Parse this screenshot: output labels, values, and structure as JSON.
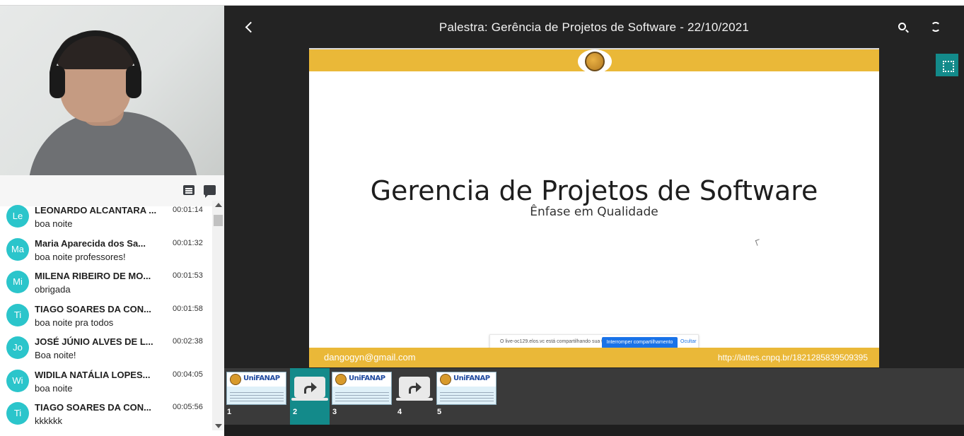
{
  "header": {
    "title": "Palestra: Gerência de Projetos de Software - 22/10/2021",
    "back_icon": "chevron-left-icon",
    "search_icon": "search-icon",
    "refresh_icon": "refresh-icon",
    "fullscreen_icon": "fullscreen-icon"
  },
  "chat": {
    "toolbar_icons": [
      "notes-icon",
      "chat-icon"
    ],
    "messages": [
      {
        "initials": "Le",
        "name": "LEONARDO ALCANTARA ...",
        "time": "00:01:14",
        "text": "boa noite"
      },
      {
        "initials": "Ma",
        "name": "Maria Aparecida dos Sa...",
        "time": "00:01:32",
        "text": "boa noite professores!"
      },
      {
        "initials": "Mi",
        "name": "MILENA RIBEIRO DE MO...",
        "time": "00:01:53",
        "text": "obrigada"
      },
      {
        "initials": "Ti",
        "name": "TIAGO SOARES DA CON...",
        "time": "00:01:58",
        "text": "boa noite pra todos"
      },
      {
        "initials": "Jo",
        "name": "JOSÉ JÚNIO ALVES DE L...",
        "time": "00:02:38",
        "text": "Boa noite!"
      },
      {
        "initials": "Wi",
        "name": "WIDILA NATÁLIA LOPES...",
        "time": "00:04:05",
        "text": "boa noite"
      },
      {
        "initials": "Ti",
        "name": "TIAGO SOARES DA CON...",
        "time": "00:05:56",
        "text": "kkkkkk"
      }
    ]
  },
  "slide": {
    "title": "Gerencia de Projetos de Software",
    "subtitle": "Ênfase em Qualidade",
    "email": "dangogyn@gmail.com",
    "url": "http://lattes.cnpq.br/1821285839509395",
    "share_notice": {
      "text": "O live-oc129.elos.vc está compartilhando sua tela.",
      "stop_label": "Interromper compartilhamento",
      "hide_label": "Ocultar"
    }
  },
  "thumbnails": [
    {
      "number": "1",
      "type": "slide",
      "brand": "UniFANAP"
    },
    {
      "number": "2",
      "type": "share",
      "active": true
    },
    {
      "number": "3",
      "type": "slide",
      "brand": "UniFANAP"
    },
    {
      "number": "4",
      "type": "share"
    },
    {
      "number": "5",
      "type": "slide",
      "brand": "UniFANAP"
    }
  ],
  "colors": {
    "accent_teal": "#138a8a",
    "avatar_cyan": "#2bc5cb",
    "slide_gold": "#eab838",
    "stage_dark": "#232323"
  }
}
